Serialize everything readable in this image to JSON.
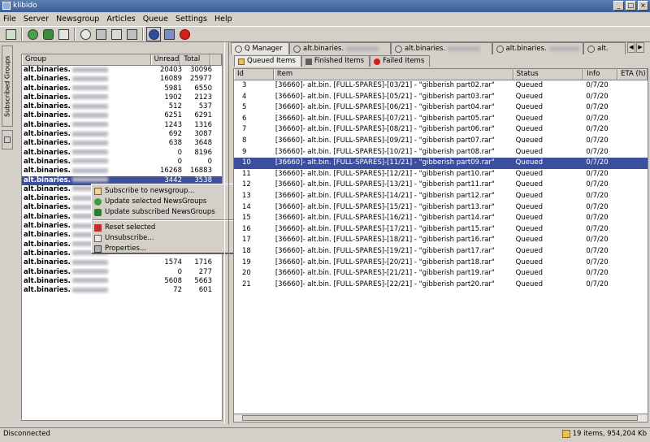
{
  "window": {
    "title": "klibido",
    "buttons": [
      "_",
      "□",
      "×"
    ]
  },
  "menu": [
    "File",
    "Server",
    "Newsgroup",
    "Articles",
    "Queue",
    "Settings",
    "Help"
  ],
  "sidebar_tabs": [
    "Subscribed Groups"
  ],
  "groups_table": {
    "headers": [
      "Group",
      "Unread",
      "Total"
    ],
    "rows": [
      {
        "name": "alt.binaries.",
        "unread": "20403",
        "total": "30096"
      },
      {
        "name": "alt.binaries.",
        "unread": "16089",
        "total": "25977"
      },
      {
        "name": "alt.binaries.",
        "unread": "5981",
        "total": "6550"
      },
      {
        "name": "alt.binaries.",
        "unread": "1902",
        "total": "2123"
      },
      {
        "name": "alt.binaries.",
        "unread": "512",
        "total": "537"
      },
      {
        "name": "alt.binaries.",
        "unread": "6251",
        "total": "6291"
      },
      {
        "name": "alt.binaries.",
        "unread": "1243",
        "total": "1316"
      },
      {
        "name": "alt.binaries.",
        "unread": "692",
        "total": "3087"
      },
      {
        "name": "alt.binaries.",
        "unread": "638",
        "total": "3648"
      },
      {
        "name": "alt.binaries.",
        "unread": "0",
        "total": "8196"
      },
      {
        "name": "alt.binaries.",
        "unread": "0",
        "total": "0"
      },
      {
        "name": "alt.binaries.",
        "unread": "16268",
        "total": "16883"
      },
      {
        "name": "alt.binaries.",
        "unread": "3442",
        "total": "3538"
      },
      {
        "name": "alt.binaries.",
        "unread": "",
        "total": ""
      },
      {
        "name": "alt.binaries.",
        "unread": "",
        "total": ""
      },
      {
        "name": "alt.binaries.",
        "unread": "",
        "total": ""
      },
      {
        "name": "alt.binaries.",
        "unread": "",
        "total": ""
      },
      {
        "name": "alt.binaries.",
        "unread": "",
        "total": ""
      },
      {
        "name": "alt.binaries.",
        "unread": "",
        "total": ""
      },
      {
        "name": "alt.binaries.",
        "unread": "",
        "total": ""
      },
      {
        "name": "alt.binaries.",
        "unread": "",
        "total": ""
      },
      {
        "name": "alt.binaries.",
        "unread": "1574",
        "total": "1716"
      },
      {
        "name": "alt.binaries.",
        "unread": "0",
        "total": "277"
      },
      {
        "name": "alt.binaries.",
        "unread": "5608",
        "total": "5663"
      },
      {
        "name": "alt.binaries.",
        "unread": "72",
        "total": "601"
      }
    ],
    "selected_index": 12
  },
  "context_menu": {
    "items": [
      {
        "label": "Subscribe to newsgroup...",
        "icon": "subscribe-icon"
      },
      {
        "label": "Update selected NewsGroups",
        "icon": "update-icon"
      },
      {
        "label": "Update subscribed NewsGroups",
        "icon": "update-all-icon"
      },
      {
        "label": "Reset selected",
        "icon": "reset-icon",
        "separator_before": true
      },
      {
        "label": "Unsubscribe...",
        "icon": "unsubscribe-icon"
      },
      {
        "label": "Properties...",
        "icon": "properties-icon"
      }
    ]
  },
  "main_tabs": [
    "Q Manager",
    "alt.binaries.",
    "alt.binaries.",
    "alt.binaries.",
    "alt."
  ],
  "queue_tabs": [
    "Queued Items",
    "Finished Items",
    "Failed Items"
  ],
  "queue_table": {
    "headers": [
      "Id",
      "Item",
      "Status",
      "Info",
      "ETA (h)"
    ],
    "rows": [
      {
        "id": "3",
        "item": "[36660]- alt.bin. [FULL-SPARES]-[03/21] - \"gibberish part02.rar\"",
        "status": "Queued",
        "info": "0/7/20"
      },
      {
        "id": "4",
        "item": "[36660]- alt.bin. [FULL-SPARES]-[05/21] - \"gibberish part03.rar\"",
        "status": "Queued",
        "info": "0/7/20"
      },
      {
        "id": "5",
        "item": "[36660]- alt.bin. [FULL-SPARES]-[06/21] - \"gibberish part04.rar\"",
        "status": "Queued",
        "info": "0/7/20"
      },
      {
        "id": "6",
        "item": "[36660]- alt.bin. [FULL-SPARES]-[07/21] - \"gibberish part05.rar\"",
        "status": "Queued",
        "info": "0/7/20"
      },
      {
        "id": "7",
        "item": "[36660]- alt.bin. [FULL-SPARES]-[08/21] - \"gibberish part06.rar\"",
        "status": "Queued",
        "info": "0/7/20"
      },
      {
        "id": "8",
        "item": "[36660]- alt.bin. [FULL-SPARES]-[09/21] - \"gibberish part07.rar\"",
        "status": "Queued",
        "info": "0/7/20"
      },
      {
        "id": "9",
        "item": "[36660]- alt.bin. [FULL-SPARES]-[10/21] - \"gibberish part08.rar\"",
        "status": "Queued",
        "info": "0/7/20"
      },
      {
        "id": "10",
        "item": "[36660]- alt.bin. [FULL-SPARES]-[11/21] - \"gibberish part09.rar\"",
        "status": "Queued",
        "info": "0/7/20"
      },
      {
        "id": "11",
        "item": "[36660]- alt.bin. [FULL-SPARES]-[12/21] - \"gibberish part10.rar\"",
        "status": "Queued",
        "info": "0/7/20"
      },
      {
        "id": "12",
        "item": "[36660]- alt.bin. [FULL-SPARES]-[13/21] - \"gibberish part11.rar\"",
        "status": "Queued",
        "info": "0/7/20"
      },
      {
        "id": "13",
        "item": "[36660]- alt.bin. [FULL-SPARES]-[14/21] - \"gibberish part12.rar\"",
        "status": "Queued",
        "info": "0/7/20"
      },
      {
        "id": "14",
        "item": "[36660]- alt.bin. [FULL-SPARES]-[15/21] - \"gibberish part13.rar\"",
        "status": "Queued",
        "info": "0/7/20"
      },
      {
        "id": "15",
        "item": "[36660]- alt.bin. [FULL-SPARES]-[16/21] - \"gibberish part14.rar\"",
        "status": "Queued",
        "info": "0/7/20"
      },
      {
        "id": "16",
        "item": "[36660]- alt.bin. [FULL-SPARES]-[17/21] - \"gibberish part15.rar\"",
        "status": "Queued",
        "info": "0/7/20"
      },
      {
        "id": "17",
        "item": "[36660]- alt.bin. [FULL-SPARES]-[18/21] - \"gibberish part16.rar\"",
        "status": "Queued",
        "info": "0/7/20"
      },
      {
        "id": "18",
        "item": "[36660]- alt.bin. [FULL-SPARES]-[19/21] - \"gibberish part17.rar\"",
        "status": "Queued",
        "info": "0/7/20"
      },
      {
        "id": "19",
        "item": "[36660]- alt.bin. [FULL-SPARES]-[20/21] - \"gibberish part18.rar\"",
        "status": "Queued",
        "info": "0/7/20"
      },
      {
        "id": "20",
        "item": "[36660]- alt.bin. [FULL-SPARES]-[21/21] - \"gibberish part19.rar\"",
        "status": "Queued",
        "info": "0/7/20"
      },
      {
        "id": "21",
        "item": "[36660]- alt.bin. [FULL-SPARES]-[22/21] - \"gibberish part20.rar\"",
        "status": "Queued",
        "info": "0/7/20"
      }
    ],
    "selected_index": 7
  },
  "status": {
    "left": "Disconnected",
    "right": "19 items, 954,204 Kb"
  },
  "colors": {
    "selection": "#3c4f9c",
    "titlebar": "#4a6ea5"
  }
}
